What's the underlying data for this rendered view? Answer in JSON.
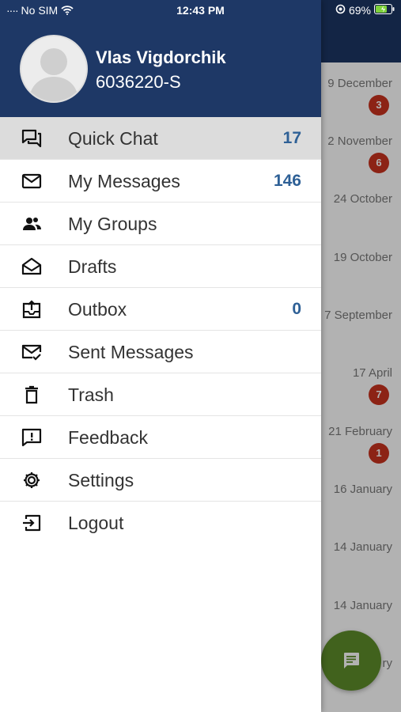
{
  "status_bar": {
    "carrier": "No SIM",
    "time": "12:43 PM",
    "battery": "69%"
  },
  "background_list": [
    {
      "date": "9 December",
      "badge": "3"
    },
    {
      "date": "2 November",
      "badge": "6"
    },
    {
      "date": "24 October",
      "badge": null
    },
    {
      "date": "19 October",
      "badge": null
    },
    {
      "date": "7 September",
      "badge": null
    },
    {
      "date": "17 April",
      "badge": "7"
    },
    {
      "date": "21 February",
      "badge": "1"
    },
    {
      "date": "16 January",
      "badge": null
    },
    {
      "date": "14 January",
      "badge": null
    },
    {
      "date": "14 January",
      "badge": null
    },
    {
      "date": "ry",
      "badge": null
    }
  ],
  "drawer": {
    "user": {
      "name": "Vlas Vigdorchik",
      "id": "6036220-S"
    },
    "menu": [
      {
        "label": "Quick Chat",
        "count": "17",
        "icon": "quick-chat-icon",
        "active": true
      },
      {
        "label": "My Messages",
        "count": "146",
        "icon": "envelope-icon"
      },
      {
        "label": "My Groups",
        "count": "",
        "icon": "group-icon"
      },
      {
        "label": "Drafts",
        "count": "",
        "icon": "open-envelope-icon"
      },
      {
        "label": "Outbox",
        "count": "0",
        "icon": "outbox-icon"
      },
      {
        "label": "Sent Messages",
        "count": "",
        "icon": "envelope-check-icon"
      },
      {
        "label": "Trash",
        "count": "",
        "icon": "trash-icon"
      },
      {
        "label": "Feedback",
        "count": "",
        "icon": "feedback-icon"
      },
      {
        "label": "Settings",
        "count": "",
        "icon": "gear-icon"
      },
      {
        "label": "Logout",
        "count": "",
        "icon": "logout-icon"
      }
    ]
  },
  "colors": {
    "header_blue": "#1e3866",
    "count_blue": "#2e6096",
    "badge_red": "#c9331f",
    "fab_green": "#5e8d2a",
    "active_row": "#dcdcdc"
  }
}
